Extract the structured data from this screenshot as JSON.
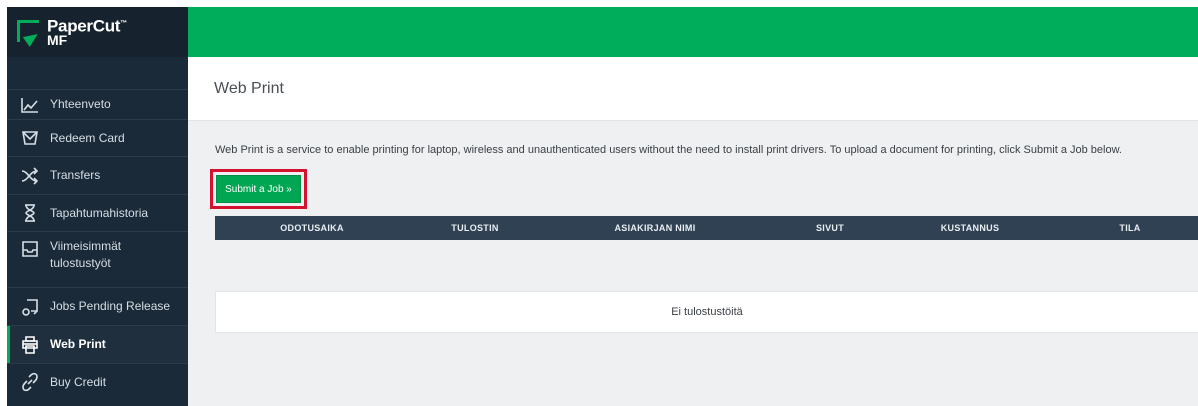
{
  "logo": {
    "brand": "PaperCut",
    "tm": "™",
    "sub": "MF"
  },
  "sidebar": {
    "items": [
      {
        "label": "Yhteenveto",
        "icon": "chart-line-icon"
      },
      {
        "label": "Redeem Card",
        "icon": "card-icon"
      },
      {
        "label": "Transfers",
        "icon": "shuffle-icon"
      },
      {
        "label": "Tapahtumahistoria",
        "icon": "hourglass-icon"
      },
      {
        "label": "Viimeisimmät tulostustyöt",
        "icon": "tray-icon"
      },
      {
        "label": "Jobs Pending Release",
        "icon": "pending-release-icon"
      },
      {
        "label": "Web Print",
        "icon": "printer-icon",
        "active": true
      },
      {
        "label": "Buy Credit",
        "icon": "link-icon"
      }
    ]
  },
  "main": {
    "title": "Web Print",
    "description": "Web Print is a service to enable printing for laptop, wireless and unauthenticated users without the need to install print drivers. To upload a document for printing, click Submit a Job below.",
    "submit_label": "Submit a Job »",
    "table": {
      "columns": [
        "ODOTUSAIKA",
        "TULOSTIN",
        "ASIAKIRJAN NIMI",
        "SIVUT",
        "KUSTANNUS",
        "TILA"
      ],
      "empty_text": "Ei tulostustöitä"
    }
  },
  "colors": {
    "accent": "#00ad5a",
    "sidebar": "#1a2a38",
    "header": "#2f4153",
    "highlight": "#d2122e"
  }
}
